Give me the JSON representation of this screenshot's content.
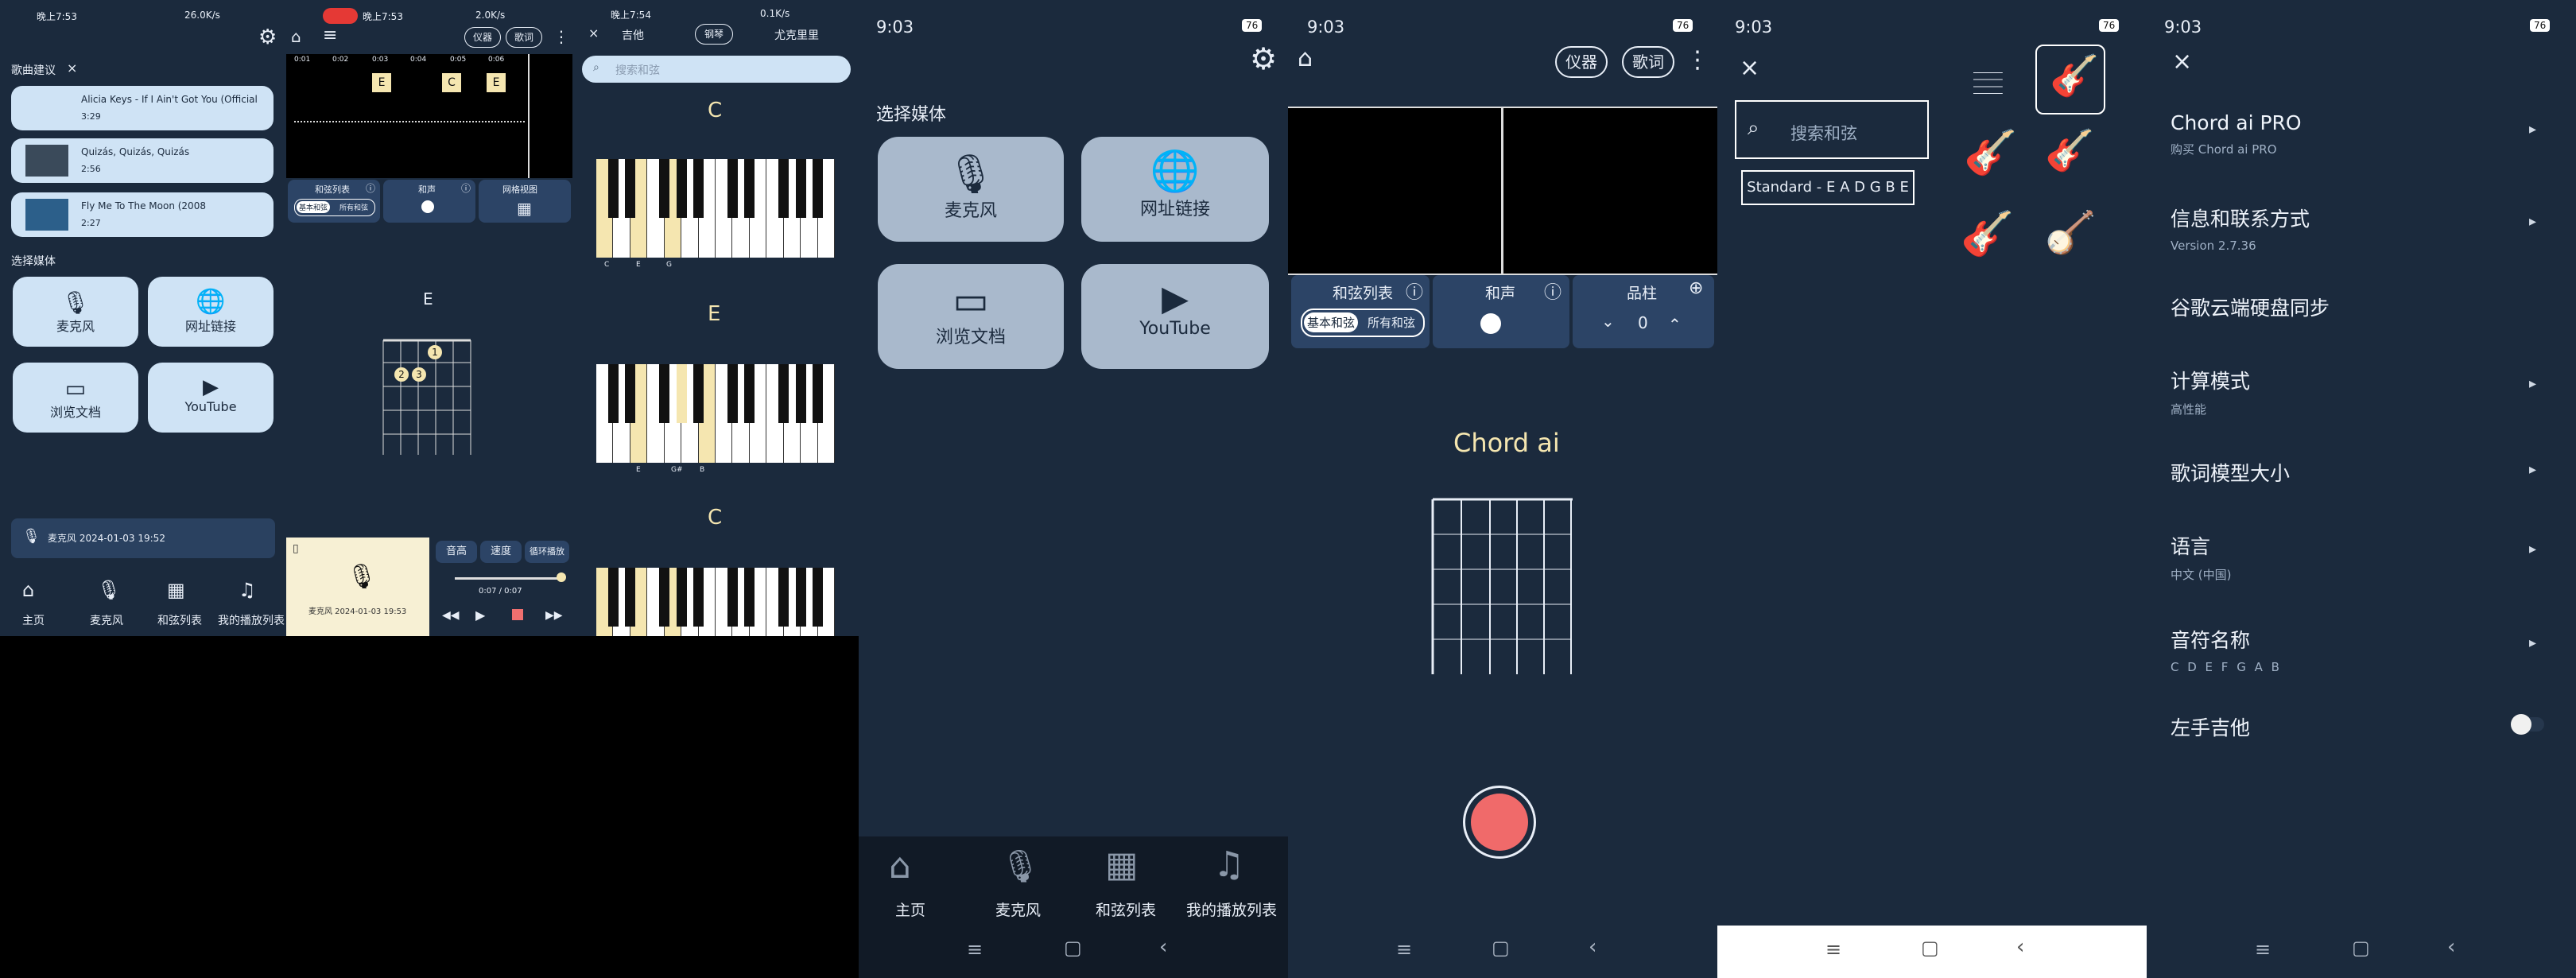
{
  "p1": {
    "status_time": "晚上7:53",
    "status_speed": "26.0K/s",
    "suggest_label": "歌曲建议",
    "suggest_close": "×",
    "songs": [
      {
        "title": "Alicia Keys - If I Ain't Got You (Official",
        "duration": "3:29"
      },
      {
        "title": "Quizás, Quizás, Quizás",
        "duration": "2:56"
      },
      {
        "title": "Fly Me To The Moon (2008",
        "duration": "2:27"
      }
    ],
    "media_label": "选择媒体",
    "tiles": [
      "麦克风",
      "网址链接",
      "浏览文档",
      "YouTube"
    ],
    "recording": "麦克风 2024-01-03 19:52",
    "nav": [
      "主页",
      "麦克风",
      "和弦列表",
      "我的播放列表"
    ]
  },
  "p2": {
    "status_time": "晚上7:53",
    "status_speed": "2.0K/s",
    "btn_instrument": "仪器",
    "btn_lyrics": "歌词",
    "timeline": [
      "0:01",
      "0:02",
      "0:03",
      "0:04",
      "0:05",
      "0:06"
    ],
    "chord_tags": [
      "E",
      "C",
      "E"
    ],
    "chord_list_label": "和弦列表",
    "seg_basic": "基本和弦",
    "seg_all": "所有和弦",
    "harmony_label": "和声",
    "grid_label": "网格视图",
    "diagram_chord": "E",
    "fingers": [
      "1",
      "2",
      "3"
    ],
    "pitch": "音高",
    "speed": "速度",
    "loop": "循环播放",
    "time_pos": "0:07 / 0:07",
    "recording": "麦克风 2024-01-03 19:53"
  },
  "p3": {
    "status_time": "晚上7:54",
    "status_speed": "0.1K/s",
    "tab_guitar": "吉他",
    "tab_piano": "钢琴",
    "tab_ukulele": "尤克里里",
    "search_placeholder": "搜索和弦",
    "chords": [
      {
        "name": "C",
        "notes": [
          "C",
          "E",
          "G"
        ]
      },
      {
        "name": "E",
        "notes": [
          "E",
          "G#",
          "B"
        ]
      },
      {
        "name": "C",
        "notes": []
      }
    ]
  },
  "p4": {
    "status_time": "9:03",
    "battery": "76",
    "media_label": "选择媒体",
    "tiles": [
      "麦克风",
      "网址链接",
      "浏览文档",
      "YouTube"
    ],
    "nav": [
      "主页",
      "麦克风",
      "和弦列表",
      "我的播放列表"
    ]
  },
  "p5": {
    "status_time": "9:03",
    "battery": "76",
    "btn_instrument": "仪器",
    "btn_lyrics": "歌词",
    "chord_list_label": "和弦列表",
    "seg_basic": "基本和弦",
    "seg_all": "所有和弦",
    "harmony_label": "和声",
    "fret_label": "品柱",
    "fret_value": "0",
    "app_name": "Chord ai"
  },
  "p6": {
    "status_time": "9:03",
    "battery": "76",
    "search_placeholder": "搜索和弦",
    "tuning": "Standard - E A D G B E"
  },
  "p7": {
    "status_time": "9:03",
    "battery": "76",
    "items": [
      {
        "title": "Chord ai PRO",
        "sub": "购买 Chord ai PRO"
      },
      {
        "title": "信息和联系方式",
        "sub": "Version 2.7.36"
      },
      {
        "title": "谷歌云端硬盘同步",
        "sub": ""
      },
      {
        "title": "计算模式",
        "sub": "高性能"
      },
      {
        "title": "歌词模型大小",
        "sub": ""
      },
      {
        "title": "语言",
        "sub": "中文 (中国)"
      },
      {
        "title": "音符名称",
        "sub": "C D E F G A B"
      },
      {
        "title": "左手吉他",
        "sub": ""
      }
    ]
  }
}
